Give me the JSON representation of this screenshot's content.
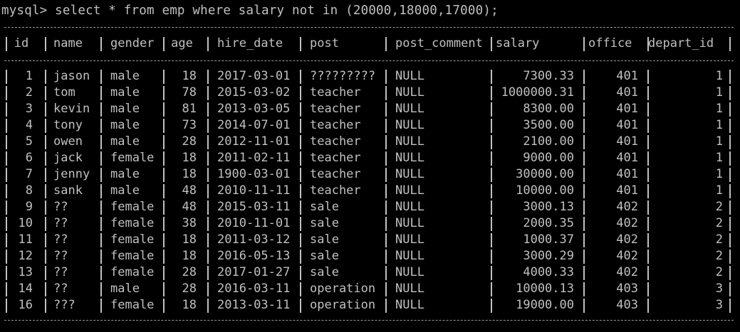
{
  "terminal": {
    "command_line": "mysql> select * from emp where salary not in (20000,18000,17000);"
  },
  "table": {
    "columns": [
      {
        "key": "id",
        "label": "id"
      },
      {
        "key": "name",
        "label": "name"
      },
      {
        "key": "gender",
        "label": "gender"
      },
      {
        "key": "age",
        "label": "age"
      },
      {
        "key": "hire_date",
        "label": "hire_date"
      },
      {
        "key": "post",
        "label": "post"
      },
      {
        "key": "post_comment",
        "label": "post_comment"
      },
      {
        "key": "salary",
        "label": "salary"
      },
      {
        "key": "office",
        "label": "office"
      },
      {
        "key": "depart_id",
        "label": "depart_id"
      }
    ],
    "rows": [
      [
        "1",
        "jason",
        "male",
        "18",
        "2017-03-01",
        "?????????",
        "NULL",
        "7300.33",
        "401",
        "1"
      ],
      [
        "2",
        "tom",
        "male",
        "78",
        "2015-03-02",
        "teacher",
        "NULL",
        "1000000.31",
        "401",
        "1"
      ],
      [
        "3",
        "kevin",
        "male",
        "81",
        "2013-03-05",
        "teacher",
        "NULL",
        "8300.00",
        "401",
        "1"
      ],
      [
        "4",
        "tony",
        "male",
        "73",
        "2014-07-01",
        "teacher",
        "NULL",
        "3500.00",
        "401",
        "1"
      ],
      [
        "5",
        "owen",
        "male",
        "28",
        "2012-11-01",
        "teacher",
        "NULL",
        "2100.00",
        "401",
        "1"
      ],
      [
        "6",
        "jack",
        "female",
        "18",
        "2011-02-11",
        "teacher",
        "NULL",
        "9000.00",
        "401",
        "1"
      ],
      [
        "7",
        "jenny",
        "male",
        "18",
        "1900-03-01",
        "teacher",
        "NULL",
        "30000.00",
        "401",
        "1"
      ],
      [
        "8",
        "sank",
        "male",
        "48",
        "2010-11-11",
        "teacher",
        "NULL",
        "10000.00",
        "401",
        "1"
      ],
      [
        "9",
        "??",
        "female",
        "48",
        "2015-03-11",
        "sale",
        "NULL",
        "3000.13",
        "402",
        "2"
      ],
      [
        "10",
        "??",
        "female",
        "38",
        "2010-11-01",
        "sale",
        "NULL",
        "2000.35",
        "402",
        "2"
      ],
      [
        "11",
        "??",
        "female",
        "18",
        "2011-03-12",
        "sale",
        "NULL",
        "1000.37",
        "402",
        "2"
      ],
      [
        "12",
        "??",
        "female",
        "18",
        "2016-05-13",
        "sale",
        "NULL",
        "3000.29",
        "402",
        "2"
      ],
      [
        "13",
        "??",
        "female",
        "28",
        "2017-01-27",
        "sale",
        "NULL",
        "4000.33",
        "402",
        "2"
      ],
      [
        "14",
        "??",
        "male",
        "28",
        "2016-03-11",
        "operation",
        "NULL",
        "10000.13",
        "403",
        "3"
      ],
      [
        "16",
        "???",
        "female",
        "18",
        "2013-03-11",
        "operation",
        "NULL",
        "19000.00",
        "403",
        "3"
      ]
    ]
  },
  "colors": {
    "background": "#000000",
    "text": "#c0c0c0"
  }
}
